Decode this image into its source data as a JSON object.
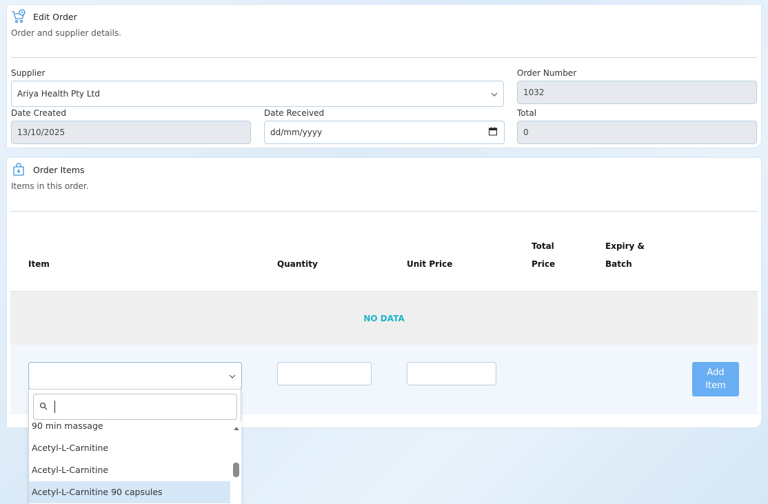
{
  "order_card": {
    "title": "Edit Order",
    "subtitle": "Order and supplier details.",
    "supplier_label": "Supplier",
    "supplier_value": "Ariya Health Pty Ltd",
    "order_number_label": "Order Number",
    "order_number_value": "1032",
    "date_created_label": "Date Created",
    "date_created_value": "13/10/2025",
    "date_received_label": "Date Received",
    "date_received_value": "dd/mm/yyyy",
    "total_label": "Total",
    "total_value": "0"
  },
  "items_card": {
    "title": "Order Items",
    "subtitle": "Items in this order.",
    "columns": {
      "item": "Item",
      "quantity": "Quantity",
      "unit_price": "Unit Price",
      "total_price_line1": "Total",
      "total_price_line2": "Price",
      "expiry_line1": "Expiry &",
      "expiry_line2": "Batch"
    },
    "no_data": "NO DATA",
    "add_button_line1": "Add",
    "add_button_line2": "Item"
  },
  "dropdown": {
    "options": [
      "90 min massage",
      "Acetyl-L-Carnitine",
      "Acetyl-L-Carnitine",
      "Acetyl-L-Carnitine 90 capsules"
    ],
    "highlighted_index": 3
  },
  "colors": {
    "accent_button": "#69aef2",
    "no_data_text": "#1fb5c9",
    "icon_blue": "#3a8fd8"
  }
}
